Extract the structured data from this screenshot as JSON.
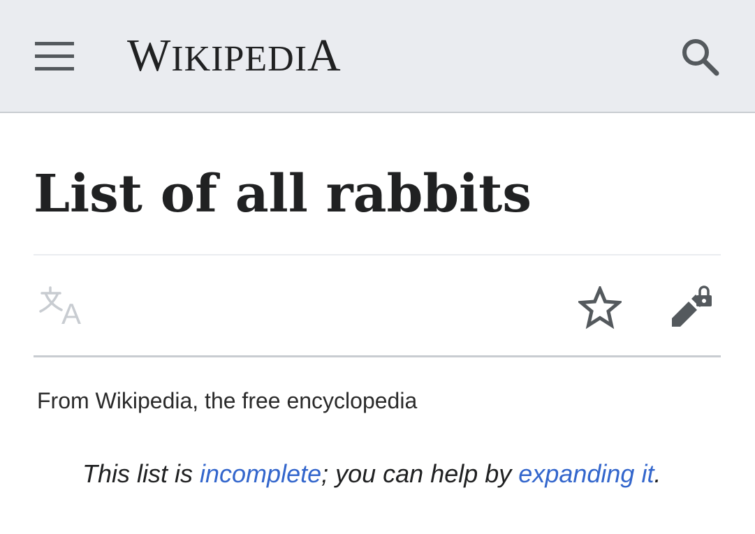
{
  "header": {
    "menu_icon": "hamburger-menu-icon",
    "wordmark": {
      "first": "W",
      "middle": "IKIPEDI",
      "last": "A"
    },
    "search_icon": "search-icon"
  },
  "page": {
    "title": "List of all rabbits",
    "actions": {
      "language_icon": "language-translate-icon",
      "watch_icon": "star-icon",
      "edit_icon": "edit-locked-icon"
    },
    "tagline": "From Wikipedia, the free encyclopedia",
    "notice": {
      "prefix": "This list is ",
      "link1": "incomplete",
      "middle": "; you can help by ",
      "link2": "expanding it",
      "suffix": "."
    }
  },
  "colors": {
    "header_bg": "#eaecf0",
    "link": "#3366cc",
    "icon": "#54595d",
    "disabled_icon": "#c8ccd1"
  }
}
